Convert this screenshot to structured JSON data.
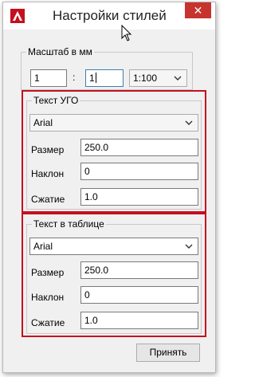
{
  "window": {
    "title": "Настройки стилей",
    "close_label": "✕"
  },
  "scale": {
    "legend": "Масштаб в мм",
    "left_value": "1",
    "separator": ":",
    "right_value": "1",
    "ratio_selected": "1:100"
  },
  "ugo_text": {
    "legend": "Текст УГО",
    "font_selected": "Arial",
    "size_label": "Размер",
    "size_value": "250.0",
    "slant_label": "Наклон",
    "slant_value": "0",
    "compress_label": "Сжатие",
    "compress_value": "1.0"
  },
  "table_text": {
    "legend": "Текст в таблице",
    "font_selected": "Arial",
    "size_label": "Размер",
    "size_value": "250.0",
    "slant_label": "Наклон",
    "slant_value": "0",
    "compress_label": "Сжатие",
    "compress_value": "1.0"
  },
  "footer": {
    "apply_label": "Принять"
  },
  "colors": {
    "highlight_box": "#c4101f",
    "close_button": "#c7332d",
    "app_icon": "#c4101f"
  }
}
